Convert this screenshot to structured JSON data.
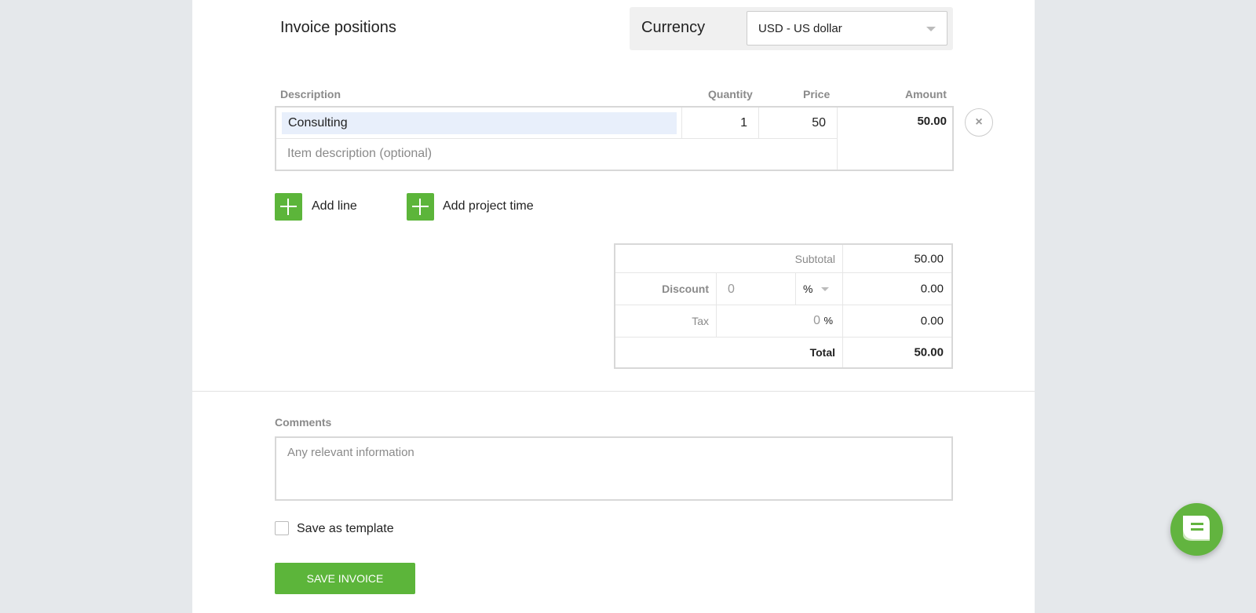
{
  "section_title": "Invoice positions",
  "currency": {
    "label": "Currency",
    "value": "USD - US dollar"
  },
  "columns": {
    "description": "Description",
    "quantity": "Quantity",
    "price": "Price",
    "amount": "Amount"
  },
  "line": {
    "description": "Consulting",
    "detail_placeholder": "Item description (optional)",
    "quantity": "1",
    "price": "50",
    "amount": "50.00"
  },
  "actions": {
    "add_line": "Add line",
    "add_project_time": "Add project time"
  },
  "totals": {
    "subtotal_label": "Subtotal",
    "subtotal": "50.00",
    "discount_label": "Discount",
    "discount_value": "0",
    "discount_unit": "%",
    "discount_amount": "0.00",
    "tax_label": "Tax",
    "tax_value": "0",
    "tax_unit": "%",
    "tax_amount": "0.00",
    "total_label": "Total",
    "total": "50.00"
  },
  "comments": {
    "label": "Comments",
    "placeholder": "Any relevant information"
  },
  "template_label": "Save as template",
  "save_button": "SAVE INVOICE",
  "colors": {
    "accent": "#5cb53a",
    "background": "#e5e8eb"
  }
}
